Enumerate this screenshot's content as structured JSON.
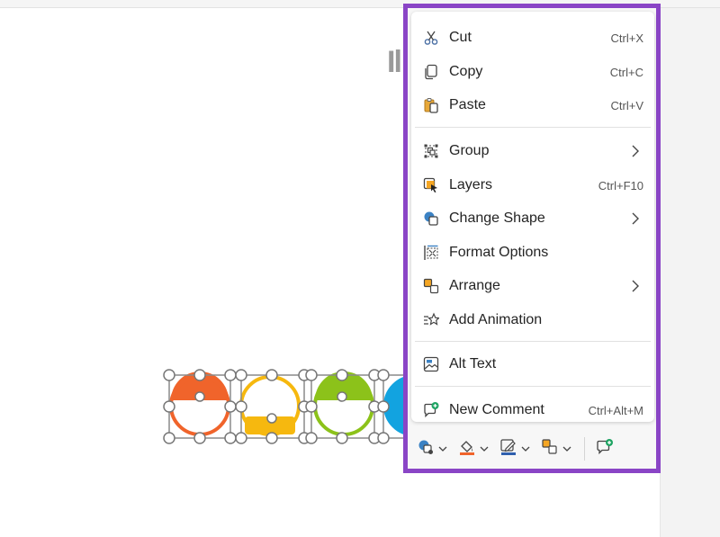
{
  "menu": {
    "items": [
      {
        "id": "cut",
        "label": "Cut",
        "shortcut": "Ctrl+X",
        "icon": "scissors-icon"
      },
      {
        "id": "copy",
        "label": "Copy",
        "shortcut": "Ctrl+C",
        "icon": "copy-icon"
      },
      {
        "id": "paste",
        "label": "Paste",
        "shortcut": "Ctrl+V",
        "icon": "paste-icon"
      },
      {
        "id": "group",
        "label": "Group",
        "shortcut": "",
        "icon": "group-icon",
        "submenu": true
      },
      {
        "id": "layers",
        "label": "Layers",
        "shortcut": "Ctrl+F10",
        "icon": "layers-icon"
      },
      {
        "id": "change-shape",
        "label": "Change Shape",
        "shortcut": "",
        "icon": "change-shape-icon",
        "submenu": true
      },
      {
        "id": "format-options",
        "label": "Format Options",
        "shortcut": "",
        "icon": "format-options-icon"
      },
      {
        "id": "arrange",
        "label": "Arrange",
        "shortcut": "",
        "icon": "arrange-icon",
        "submenu": true
      },
      {
        "id": "add-animation",
        "label": "Add Animation",
        "shortcut": "",
        "icon": "star-icon"
      },
      {
        "id": "alt-text",
        "label": "Alt Text",
        "shortcut": "",
        "icon": "image-icon"
      },
      {
        "id": "new-comment",
        "label": "New Comment",
        "shortcut": "Ctrl+Alt+M",
        "icon": "new-comment-icon"
      }
    ]
  },
  "toolbar": {
    "buttons": [
      "shape-fill-icon",
      "paint-bucket-icon",
      "pen-outline-icon",
      "arrange-icon",
      "new-comment-icon"
    ]
  },
  "colors": {
    "highlight_border": "#8a45c6",
    "shape_orange": "#f0642b",
    "shape_yellow": "#f6b80f",
    "shape_green": "#8cc21a",
    "shape_blue": "#12a3e0",
    "comment_green": "#1fa463"
  }
}
